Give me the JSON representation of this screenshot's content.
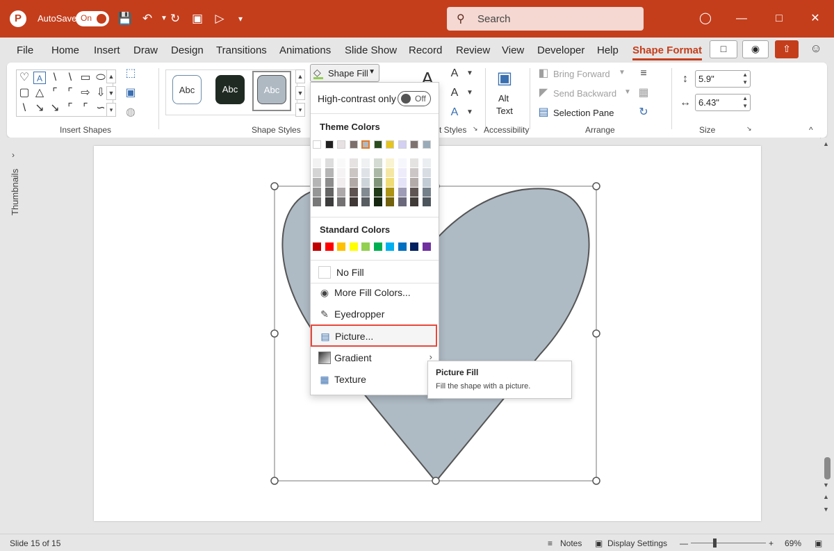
{
  "titlebar": {
    "autosave_label": "AutoSave",
    "autosave_state": "On",
    "search_placeholder": "Search",
    "accent": "#c43e1c"
  },
  "menu": {
    "tabs": [
      "File",
      "Home",
      "Insert",
      "Draw",
      "Design",
      "Transitions",
      "Animations",
      "Slide Show",
      "Record",
      "Review",
      "View",
      "Developer",
      "Help",
      "Shape Format"
    ],
    "active_tab": "Shape Format"
  },
  "ribbon": {
    "groups": {
      "insert_shapes": "Insert Shapes",
      "shape_styles": "Shape Styles",
      "wordart_styles_partial": "t Styles",
      "accessibility": "Accessibility",
      "arrange": "Arrange",
      "size": "Size"
    },
    "style_samples": [
      "Abc",
      "Abc",
      "Abc"
    ],
    "shape_fill_label": "Shape Fill",
    "alt_text_line1": "Alt",
    "alt_text_line2": "Text",
    "bring_forward": "Bring Forward",
    "send_backward": "Send Backward",
    "selection_pane": "Selection Pane",
    "height_value": "5.9\"",
    "width_value": "6.43\""
  },
  "thumbnails_label": "Thumbnails",
  "shape_fill_menu": {
    "high_contrast_label": "High-contrast only",
    "high_contrast_state": "Off",
    "theme_colors_heading": "Theme Colors",
    "standard_colors_heading": "Standard Colors",
    "theme_top_row": [
      "#ffffff",
      "#1f1f1f",
      "#e7e1e4",
      "#7d6f6b",
      "#aeb9c2",
      "#2a4d1e",
      "#e6c41a",
      "#d4d0f4",
      "#7f7370",
      "#9aaab8"
    ],
    "standard_colors": [
      "#c00000",
      "#ff0000",
      "#ffc000",
      "#ffff00",
      "#92d050",
      "#00b050",
      "#00b0f0",
      "#0070c0",
      "#002060",
      "#7030a0"
    ],
    "items": {
      "no_fill": "No Fill",
      "more_fill_colors": "More Fill Colors...",
      "eyedropper": "Eyedropper",
      "picture": "Picture...",
      "gradient": "Gradient",
      "texture": "Texture"
    }
  },
  "tooltip": {
    "title": "Picture Fill",
    "body": "Fill the shape with a picture."
  },
  "status": {
    "slide_counter": "Slide 15 of 15",
    "notes": "Notes",
    "display_settings": "Display Settings",
    "zoom_percent": "69%"
  }
}
